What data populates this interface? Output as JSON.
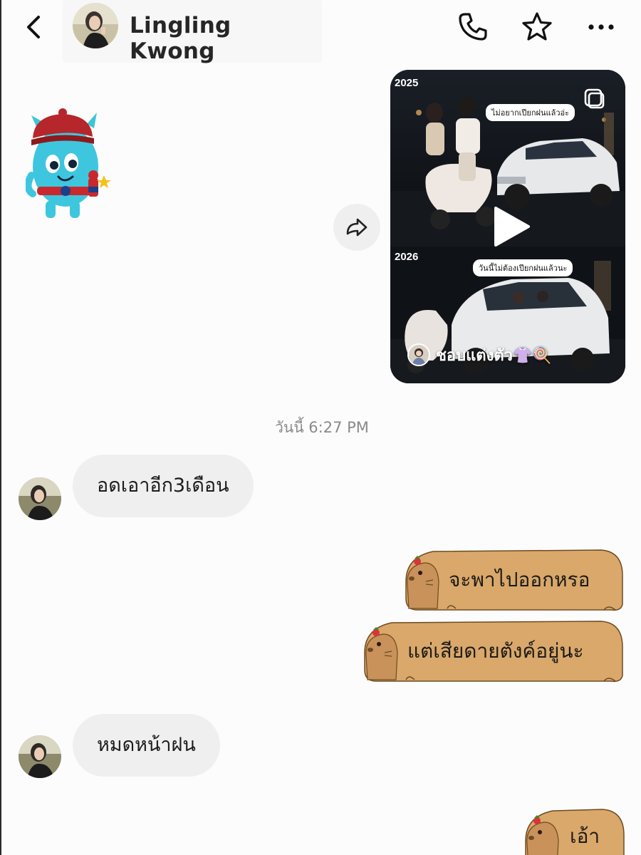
{
  "header": {
    "contact_name": "Lingling Kwong",
    "back_icon": "chevron-left-icon",
    "call_icon": "phone-icon",
    "favorite_icon": "star-icon",
    "more_icon": "more-horizontal-icon"
  },
  "shared_reel": {
    "year_top": "2025",
    "year_bottom": "2026",
    "caption_top": "ไม่อยากเปียกฝนแล้วอ่ะ",
    "caption_bottom": "วันนี้ไม่ต้องเปียกฝนแล้วนะ",
    "owner_name": "ชอบแต่งตัว👚🍭",
    "share_icon": "share-arrow-icon",
    "play_icon": "play-icon"
  },
  "timestamp": "วันนี้ 6:27 PM",
  "messages": {
    "incoming_1": "อดเอาอีก3เดือน",
    "outgoing_1": "จะพาไปออกหรอ",
    "outgoing_2": "แต่เสียดายตังค์อยู่นะ",
    "incoming_2": "หมดหน้าฝน",
    "outgoing_3": "เอ้า"
  },
  "colors": {
    "incoming_bubble": "#efefef",
    "capybara_bubble": "#d9a86a",
    "background": "#fcfcfc"
  }
}
